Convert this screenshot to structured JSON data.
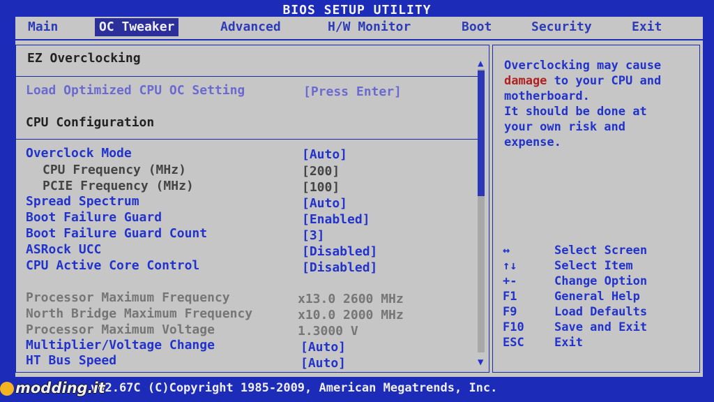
{
  "title": "BIOS SETUP UTILITY",
  "tabs": [
    {
      "label": "Main"
    },
    {
      "label": "OC Tweaker",
      "active": true
    },
    {
      "label": "Advanced"
    },
    {
      "label": "H/W Monitor"
    },
    {
      "label": "Boot"
    },
    {
      "label": "Security"
    },
    {
      "label": "Exit"
    }
  ],
  "sections": {
    "ez": "EZ Overclocking",
    "load_optimized": {
      "label": "Load Optimized CPU OC Setting",
      "value": "[Press Enter]"
    },
    "cpu_config": "CPU Configuration"
  },
  "settings": [
    {
      "label": "Overclock Mode",
      "value": "[Auto]"
    },
    {
      "label": "CPU Frequency (MHz)",
      "value": "[200]"
    },
    {
      "label": "PCIE Frequency (MHz)",
      "value": "[100]"
    },
    {
      "label": "Spread Spectrum",
      "value": "[Auto]"
    },
    {
      "label": "Boot Failure Guard",
      "value": "[Enabled]"
    },
    {
      "label": "Boot Failure Guard Count",
      "value": "[3]"
    },
    {
      "label": "ASRock UCC",
      "value": "[Disabled]"
    },
    {
      "label": "CPU Active Core Control",
      "value": "[Disabled]"
    }
  ],
  "info": [
    {
      "label": "Processor Maximum Frequency",
      "value": "x13.0 2600 MHz"
    },
    {
      "label": "North Bridge Maximum Frequency",
      "value": "x10.0 2000 MHz"
    },
    {
      "label": "Processor Maximum Voltage",
      "value": "1.3000 V"
    }
  ],
  "settings2": [
    {
      "label": "Multiplier/Voltage Change",
      "value": "[Auto]"
    },
    {
      "label": "HT Bus Speed",
      "value": "[Auto]"
    }
  ],
  "help": {
    "line1": "Overclocking may cause",
    "warn_word": "damage",
    "line2_rest": " to your CPU and",
    "line3": "motherboard.",
    "line4": "It should be done at",
    "line5": "your own risk and",
    "line6": "expense."
  },
  "keys": [
    {
      "key": "↔",
      "desc": "Select Screen"
    },
    {
      "key": "↑↓",
      "desc": "Select Item"
    },
    {
      "key": "+-",
      "desc": "Change Option"
    },
    {
      "key": "F1",
      "desc": "General Help"
    },
    {
      "key": "F9",
      "desc": "Load Defaults"
    },
    {
      "key": "F10",
      "desc": "Save and Exit"
    },
    {
      "key": "ESC",
      "desc": "Exit"
    }
  ],
  "footer": "v02.67C (C)Copyright 1985-2009, American Megatrends, Inc.",
  "watermark": "modding.it",
  "colors": {
    "background": "#1c2bb8",
    "panel": "#c6c6c6",
    "accent": "#2233cc",
    "warn": "#b02020"
  }
}
